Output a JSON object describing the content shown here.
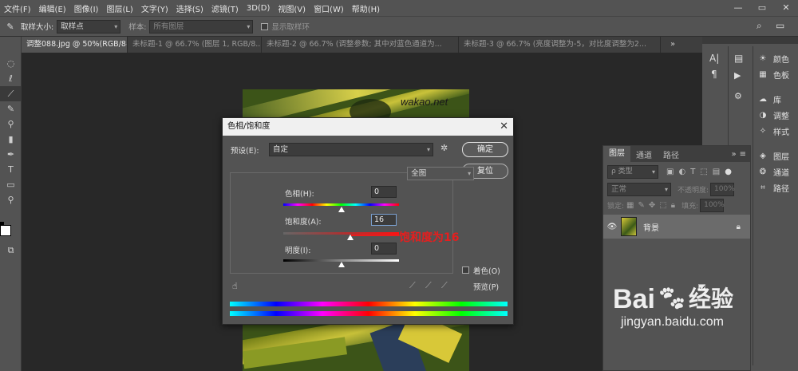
{
  "menu": [
    "文件(F)",
    "编辑(E)",
    "图像(I)",
    "图层(L)",
    "文字(Y)",
    "选择(S)",
    "滤镜(T)",
    "3D(D)",
    "视图(V)",
    "窗口(W)",
    "帮助(H)"
  ],
  "window_controls": [
    "—",
    "▭",
    "✕"
  ],
  "options_bar": {
    "sample_size_label": "取样大小:",
    "sample_size_value": "取样点",
    "sample_label": "样本:",
    "sample_value": "所有图层",
    "show_ring_label": "显示取样环"
  },
  "tabs": [
    {
      "label": "调整088.jpg @ 50%(RGB/8#) *",
      "active": true
    },
    {
      "label": "未标题-1 @ 66.7% (图层 1, RGB/8...",
      "active": false
    },
    {
      "label": "未标题-2 @ 66.7% (调整参数; 其中对蓝色通道为...",
      "active": false
    },
    {
      "label": "未标题-3 @ 66.7% (亮度调整为-5，对比度调整为2...",
      "active": false
    }
  ],
  "photo_watermark": "wakao.net",
  "right_panels": {
    "col1": [
      "A|",
      "¶"
    ],
    "col2": [
      {
        "icon": "palette-icon",
        "label": "颜色"
      },
      {
        "icon": "swatches-icon",
        "label": "色板"
      },
      {
        "icon": "library-icon",
        "label": "库"
      },
      {
        "icon": "adjust-icon",
        "label": "调整"
      },
      {
        "icon": "styles-icon",
        "label": "样式"
      },
      {
        "icon": "layers-icon",
        "label": "图层"
      },
      {
        "icon": "channels-icon",
        "label": "通道"
      },
      {
        "icon": "paths-icon",
        "label": "路径"
      }
    ]
  },
  "layers_panel": {
    "tabs": [
      "图层",
      "通道",
      "路径"
    ],
    "filter_label": "ρ 类型",
    "blend_mode": "正常",
    "opacity_label": "不透明度:",
    "opacity_value": "100%",
    "lock_label": "锁定:",
    "fill_label": "填充:",
    "fill_value": "100%",
    "layer_name": "背景"
  },
  "dialog": {
    "title": "色相/饱和度",
    "preset_label": "预设(E):",
    "preset_value": "自定",
    "ok_label": "确定",
    "reset_label": "复位",
    "channel_value": "全图",
    "hue_label": "色相(H):",
    "hue_value": "0",
    "saturation_label": "饱和度(A):",
    "saturation_value": "16",
    "lightness_label": "明度(I):",
    "lightness_value": "0",
    "colorize_label": "着色(O)",
    "preview_label": "预览(P)",
    "hue_slider": 0.5,
    "saturation_slider": 0.58,
    "lightness_slider": 0.5,
    "colorize_checked": false,
    "preview_checked": true
  },
  "annotation": "饱和度为16",
  "watermark": {
    "brand": "Bai",
    "du": "经验",
    "url": "jingyan.baidu.com"
  }
}
